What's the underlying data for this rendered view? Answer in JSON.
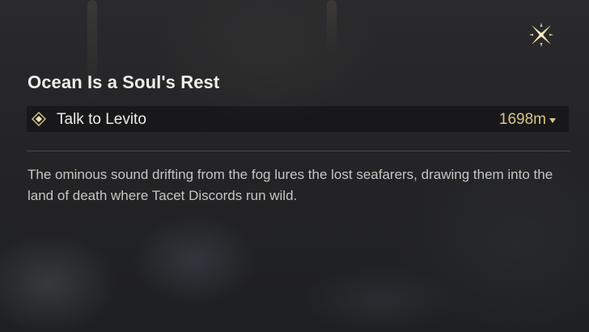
{
  "header": {
    "close_icon": "close-x-icon"
  },
  "quest": {
    "title": "Ocean Is a Soul's Rest",
    "objective": {
      "icon": "diamond-marker-icon",
      "label": "Talk to Levito",
      "distance": "1698m",
      "distance_icon": "caret-down-icon"
    },
    "description": "The ominous sound drifting from the fog lures the lost seafarers, drawing them into the land of death where Tacet Discords run wild."
  },
  "colors": {
    "title": "#f1efea",
    "distance": "#d9c48a",
    "description": "#c7c5c0",
    "accent": "#f2e3b3"
  }
}
